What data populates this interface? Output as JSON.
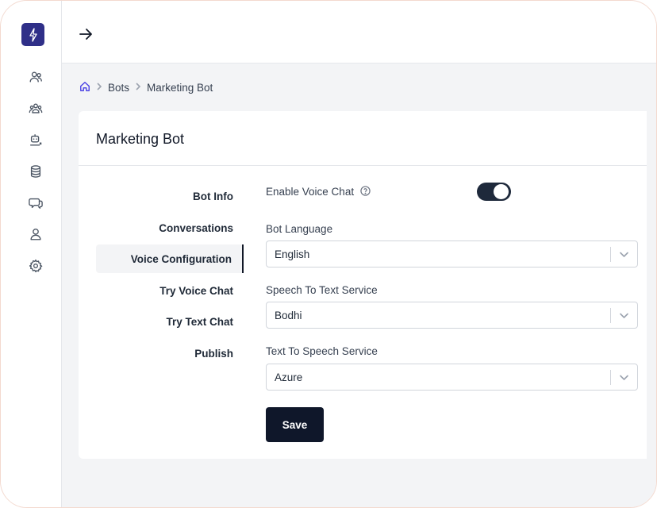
{
  "sidebar": {
    "logo_icon": "lightning-icon",
    "items": [
      {
        "icon": "users-icon"
      },
      {
        "icon": "team-icon"
      },
      {
        "icon": "bot-icon"
      },
      {
        "icon": "database-icon"
      },
      {
        "icon": "chat-icon"
      },
      {
        "icon": "user-icon"
      },
      {
        "icon": "settings-icon"
      }
    ]
  },
  "topbar": {
    "expand_icon": "arrow-right-icon"
  },
  "breadcrumb": {
    "home_icon": "home-icon",
    "items": [
      "Bots",
      "Marketing Bot"
    ]
  },
  "card": {
    "title": "Marketing Bot",
    "tabs": [
      {
        "label": "Bot Info",
        "active": false
      },
      {
        "label": "Conversations",
        "active": false
      },
      {
        "label": "Voice Configuration",
        "active": true
      },
      {
        "label": "Try Voice Chat",
        "active": false
      },
      {
        "label": "Try Text Chat",
        "active": false
      },
      {
        "label": "Publish",
        "active": false
      }
    ],
    "voice_chat": {
      "label": "Enable Voice Chat",
      "enabled": true,
      "help_icon": "help-circle-icon"
    },
    "bot_language": {
      "label": "Bot Language",
      "value": "English"
    },
    "stt_service": {
      "label": "Speech To Text Service",
      "value": "Bodhi"
    },
    "tts_service": {
      "label": "Text To Speech Service",
      "value": "Azure"
    },
    "save_label": "Save"
  },
  "colors": {
    "brand": "#2f2f88",
    "primary_dark": "#0f172a",
    "accent": "#4f46e5",
    "frame_border": "#f3d9cf"
  }
}
